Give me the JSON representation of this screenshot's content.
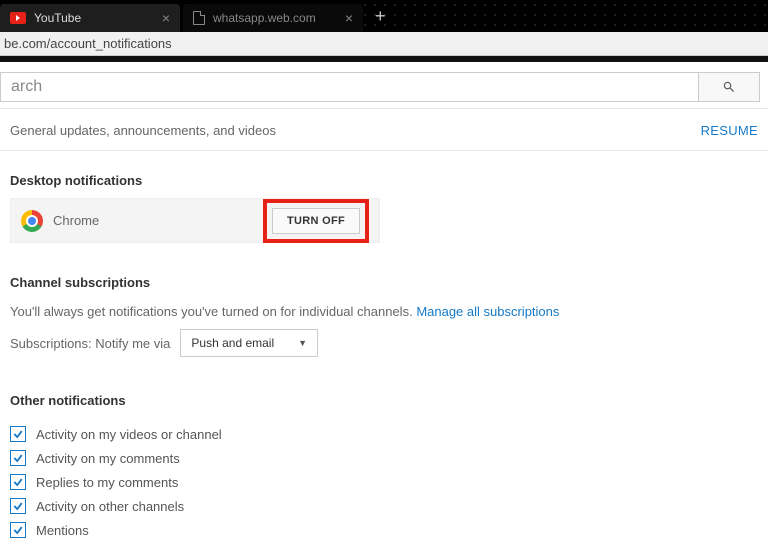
{
  "tabs": {
    "active": "YouTube",
    "inactive": "whatsapp.web.com"
  },
  "url": "be.com/account_notifications",
  "search": {
    "placeholder": "arch"
  },
  "general": {
    "desc": "General updates, announcements, and videos",
    "resume": "RESUME"
  },
  "desktop": {
    "heading": "Desktop notifications",
    "browser": "Chrome",
    "turnoff": "TURN OFF"
  },
  "channel": {
    "heading": "Channel subscriptions",
    "desc": "You'll always get notifications you've turned on for individual channels.",
    "link": "Manage all subscriptions",
    "notify_label": "Subscriptions: Notify me via",
    "notify_value": "Push and email"
  },
  "other": {
    "heading": "Other notifications",
    "items": [
      "Activity on my videos or channel",
      "Activity on my comments",
      "Replies to my comments",
      "Activity on other channels",
      "Mentions"
    ]
  }
}
